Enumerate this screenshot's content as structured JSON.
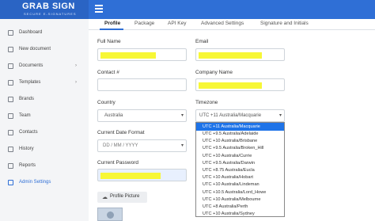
{
  "header": {
    "logo_main": "GRAB SIGN",
    "logo_sub": "SECURE E-SIGNATURES",
    "brand_color": "#2f6fd6"
  },
  "sidebar": {
    "items": [
      {
        "label": "Dashboard",
        "icon": "dashboard-icon"
      },
      {
        "label": "New document",
        "icon": "new-document-icon"
      },
      {
        "label": "Documents",
        "icon": "documents-icon",
        "has_chevron": true
      },
      {
        "label": "Templates",
        "icon": "templates-icon",
        "has_chevron": true
      },
      {
        "label": "Brands",
        "icon": "brands-icon"
      },
      {
        "label": "Team",
        "icon": "team-icon"
      },
      {
        "label": "Contacts",
        "icon": "contacts-icon"
      },
      {
        "label": "History",
        "icon": "history-icon"
      },
      {
        "label": "Reports",
        "icon": "reports-icon"
      },
      {
        "label": "Admin Settings",
        "icon": "admin-settings-icon",
        "active": true
      }
    ],
    "chevron": "›"
  },
  "tabs": [
    {
      "label": "Profile",
      "active": true
    },
    {
      "label": "Package"
    },
    {
      "label": "API Key"
    },
    {
      "label": "Advanced Settings"
    },
    {
      "label": "Signature and Initials"
    }
  ],
  "form": {
    "full_name_label": "Full Name",
    "email_label": "Email",
    "contact_label": "Contact #",
    "company_label": "Company Name",
    "country_label": "Country",
    "country_value": "Australia",
    "timezone_label": "Timezone",
    "timezone_value": "UTC +11 Australia/Macquarie",
    "date_format_label": "Current Date Format",
    "date_format_value": "DD / MM / YYYY",
    "password_label": "Current Password",
    "profile_picture_button": "Profile Picture",
    "redaction_color": "#f7f736"
  },
  "timezone_options": [
    {
      "label": "UTC +11 Australia/Macquarie",
      "selected": true
    },
    {
      "label": "UTC +9.5 Australia/Adelaide"
    },
    {
      "label": "UTC +10 Australia/Brisbane"
    },
    {
      "label": "UTC +9.5 Australia/Broken_Hill"
    },
    {
      "label": "UTC +10 Australia/Currie"
    },
    {
      "label": "UTC +9.5 Australia/Darwin"
    },
    {
      "label": "UTC +8.75 Australia/Eucla"
    },
    {
      "label": "UTC +10 Australia/Hobart"
    },
    {
      "label": "UTC +10 Australia/Lindeman"
    },
    {
      "label": "UTC +10.5 Australia/Lord_Howe"
    },
    {
      "label": "UTC +10 Australia/Melbourne"
    },
    {
      "label": "UTC +8 Australia/Perth"
    },
    {
      "label": "UTC +10 Australia/Sydney"
    }
  ]
}
